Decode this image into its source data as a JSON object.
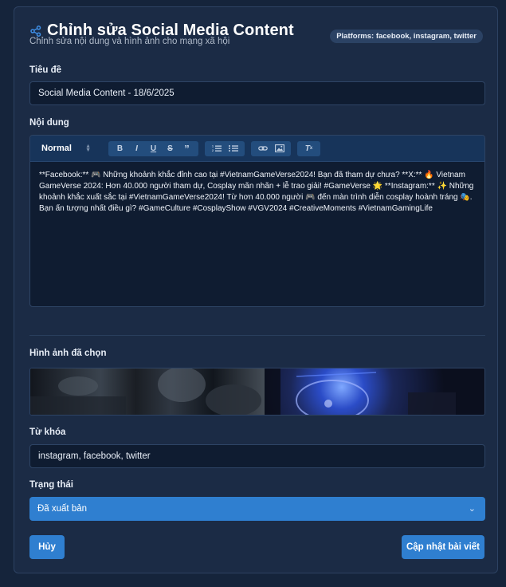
{
  "header": {
    "title": "Chỉnh sửa Social Media Content",
    "subtitle": "Chỉnh sửa nội dung và hình ảnh cho mạng xã hội",
    "platforms_badge": "Platforms: facebook, instagram, twitter"
  },
  "form": {
    "title_label": "Tiêu đề",
    "title_value": "Social Media Content - 18/6/2025",
    "content_label": "Nội dung",
    "editor": {
      "format_select": "Normal",
      "toolbar_icons": [
        "bold-icon",
        "italic-icon",
        "underline-icon",
        "strikethrough-icon",
        "quote-icon",
        "ordered-list-icon",
        "bullet-list-icon",
        "link-icon",
        "image-icon",
        "clear-format-icon"
      ],
      "content": "**Facebook:** 🎮 Những khoảnh khắc đỉnh cao tại #VietnamGameVerse2024! Bạn đã tham dự chưa? **X:** 🔥 Vietnam GameVerse 2024: Hơn 40.000 người tham dự, Cosplay mãn nhãn + lễ trao giải! #GameVerse 🌟 **Instagram:** ✨ Những khoảnh khắc xuất sắc tại #VietnamGameVerse2024! Từ hơn 40.000 người 🎮 đến màn trình diễn cosplay hoành tráng 🎭. Bạn ấn tượng nhất điều gì? #GameCulture #CosplayShow #VGV2024 #CreativeMoments #VietnamGamingLife"
    },
    "images_label": "Hình ảnh đã chọn",
    "keywords_label": "Từ khóa",
    "keywords_value": "instagram, facebook, twitter",
    "status_label": "Trạng thái",
    "status_value": "Đã xuất bản"
  },
  "actions": {
    "cancel_label": "Hủy",
    "update_label": "Cập nhật bài viết"
  },
  "colors": {
    "page_bg": "#15243b",
    "card_bg": "#1b2b45",
    "accent": "#2f7fd0"
  }
}
